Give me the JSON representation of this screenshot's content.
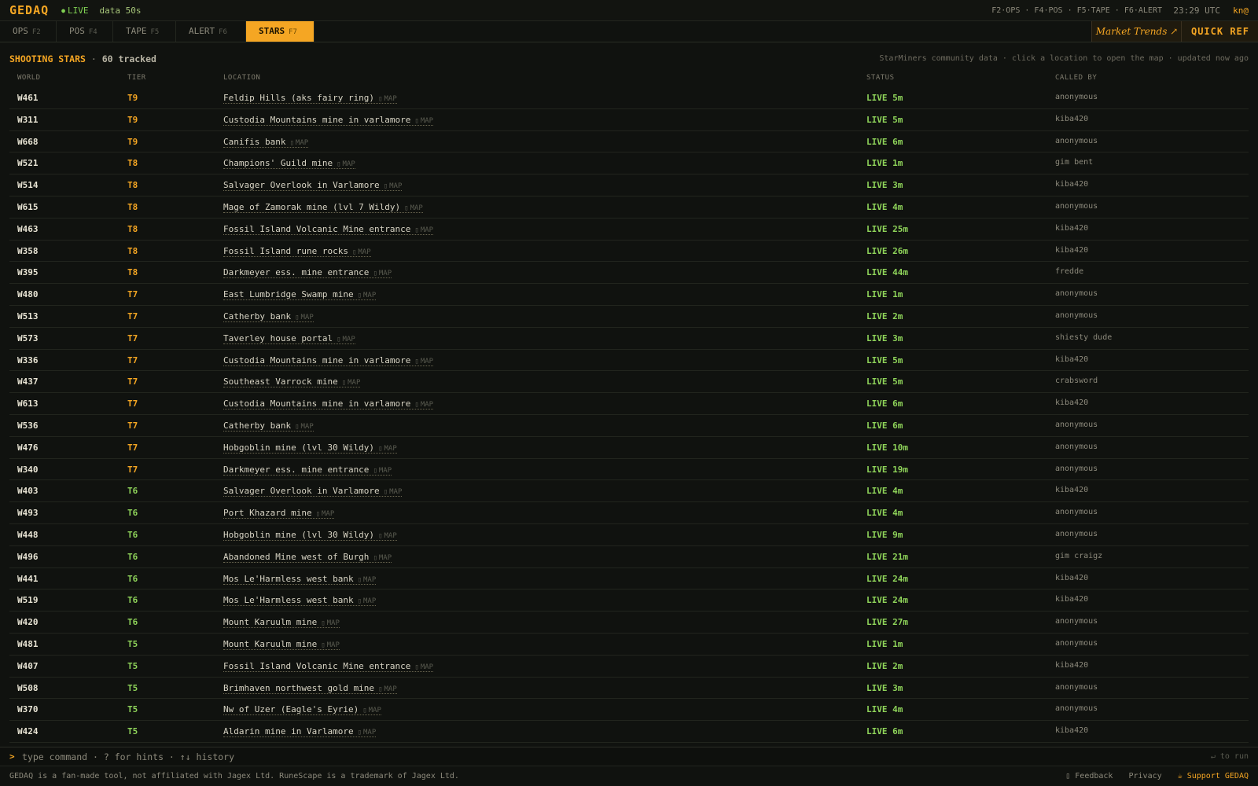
{
  "header": {
    "logo": "GEDAQ",
    "live_dot": "●",
    "live": "LIVE",
    "data_age": "data 50s",
    "hotkeys": "F2·OPS · F4·POS · F5·TAPE · F6·ALERT",
    "clock": "23:29 UTC",
    "user": "kn@"
  },
  "tabs": [
    {
      "label": "OPS",
      "key": "F2"
    },
    {
      "label": "POS",
      "key": "F4"
    },
    {
      "label": "TAPE",
      "key": "F5"
    },
    {
      "label": "ALERT",
      "key": "F6"
    },
    {
      "label": "STARS",
      "key": "F7"
    }
  ],
  "active_tab": "STARS",
  "right_buttons": {
    "trends": "Market Trends ↗",
    "quickref": "QUICK REF"
  },
  "section": {
    "title": "SHOOTING STARS",
    "sep": " · ",
    "count": "60 tracked",
    "note": "StarMiners community data · click a location to open the map · updated now ago"
  },
  "columns": {
    "world": "WORLD",
    "tier": "TIER",
    "location": "LOCATION",
    "status": "STATUS",
    "called_by": "CALLED BY"
  },
  "map_label": "MAP",
  "map_icon": "▯",
  "colors": {
    "accent": "#f5a623",
    "live": "#8fd45a",
    "background": "#10120f"
  },
  "rows": [
    {
      "world": "W461",
      "tier": "T9",
      "location": "Feldip Hills (aks fairy ring)",
      "status": "LIVE 5m",
      "caller": "anonymous"
    },
    {
      "world": "W311",
      "tier": "T9",
      "location": "Custodia Mountains mine in varlamore",
      "status": "LIVE 5m",
      "caller": "kiba420"
    },
    {
      "world": "W668",
      "tier": "T9",
      "location": "Canifis bank",
      "status": "LIVE 6m",
      "caller": "anonymous"
    },
    {
      "world": "W521",
      "tier": "T8",
      "location": "Champions' Guild mine",
      "status": "LIVE 1m",
      "caller": "gim bent"
    },
    {
      "world": "W514",
      "tier": "T8",
      "location": "Salvager Overlook in Varlamore",
      "status": "LIVE 3m",
      "caller": "kiba420"
    },
    {
      "world": "W615",
      "tier": "T8",
      "location": "Mage of Zamorak mine (lvl 7 Wildy)",
      "status": "LIVE 4m",
      "caller": "anonymous"
    },
    {
      "world": "W463",
      "tier": "T8",
      "location": "Fossil Island Volcanic Mine entrance",
      "status": "LIVE 25m",
      "caller": "kiba420"
    },
    {
      "world": "W358",
      "tier": "T8",
      "location": "Fossil Island rune rocks",
      "status": "LIVE 26m",
      "caller": "kiba420"
    },
    {
      "world": "W395",
      "tier": "T8",
      "location": "Darkmeyer ess. mine entrance",
      "status": "LIVE 44m",
      "caller": "fredde"
    },
    {
      "world": "W480",
      "tier": "T7",
      "location": "East Lumbridge Swamp mine",
      "status": "LIVE 1m",
      "caller": "anonymous"
    },
    {
      "world": "W513",
      "tier": "T7",
      "location": "Catherby bank",
      "status": "LIVE 2m",
      "caller": "anonymous"
    },
    {
      "world": "W573",
      "tier": "T7",
      "location": "Taverley house portal",
      "status": "LIVE 3m",
      "caller": "shiesty dude"
    },
    {
      "world": "W336",
      "tier": "T7",
      "location": "Custodia Mountains mine in varlamore",
      "status": "LIVE 5m",
      "caller": "kiba420"
    },
    {
      "world": "W437",
      "tier": "T7",
      "location": "Southeast Varrock mine",
      "status": "LIVE 5m",
      "caller": "crabsword"
    },
    {
      "world": "W613",
      "tier": "T7",
      "location": "Custodia Mountains mine in varlamore",
      "status": "LIVE 6m",
      "caller": "kiba420"
    },
    {
      "world": "W536",
      "tier": "T7",
      "location": "Catherby bank",
      "status": "LIVE 6m",
      "caller": "anonymous"
    },
    {
      "world": "W476",
      "tier": "T7",
      "location": "Hobgoblin mine (lvl 30 Wildy)",
      "status": "LIVE 10m",
      "caller": "anonymous"
    },
    {
      "world": "W340",
      "tier": "T7",
      "location": "Darkmeyer ess. mine entrance",
      "status": "LIVE 19m",
      "caller": "anonymous"
    },
    {
      "world": "W403",
      "tier": "T6",
      "location": "Salvager Overlook in Varlamore",
      "status": "LIVE 4m",
      "caller": "kiba420"
    },
    {
      "world": "W493",
      "tier": "T6",
      "location": "Port Khazard mine",
      "status": "LIVE 4m",
      "caller": "anonymous"
    },
    {
      "world": "W448",
      "tier": "T6",
      "location": "Hobgoblin mine (lvl 30 Wildy)",
      "status": "LIVE 9m",
      "caller": "anonymous"
    },
    {
      "world": "W496",
      "tier": "T6",
      "location": "Abandoned Mine west of Burgh",
      "status": "LIVE 21m",
      "caller": "gim craigz"
    },
    {
      "world": "W441",
      "tier": "T6",
      "location": "Mos Le'Harmless west bank",
      "status": "LIVE 24m",
      "caller": "kiba420"
    },
    {
      "world": "W519",
      "tier": "T6",
      "location": "Mos Le'Harmless west bank",
      "status": "LIVE 24m",
      "caller": "kiba420"
    },
    {
      "world": "W420",
      "tier": "T6",
      "location": "Mount Karuulm mine",
      "status": "LIVE 27m",
      "caller": "anonymous"
    },
    {
      "world": "W481",
      "tier": "T5",
      "location": "Mount Karuulm mine",
      "status": "LIVE 1m",
      "caller": "anonymous"
    },
    {
      "world": "W407",
      "tier": "T5",
      "location": "Fossil Island Volcanic Mine entrance",
      "status": "LIVE 2m",
      "caller": "kiba420"
    },
    {
      "world": "W508",
      "tier": "T5",
      "location": "Brimhaven northwest gold mine",
      "status": "LIVE 3m",
      "caller": "anonymous"
    },
    {
      "world": "W370",
      "tier": "T5",
      "location": "Nw of Uzer (Eagle's Eyrie)",
      "status": "LIVE 4m",
      "caller": "anonymous"
    },
    {
      "world": "W424",
      "tier": "T5",
      "location": "Aldarin mine in Varlamore",
      "status": "LIVE 6m",
      "caller": "kiba420"
    }
  ],
  "command": {
    "prompt": ">",
    "placeholder": "type command · ? for hints · ↑↓ history",
    "run_hint": "↵ to run"
  },
  "footer": {
    "disclaimer": "GEDAQ is a fan-made tool, not affiliated with Jagex Ltd. RuneScape is a trademark of Jagex Ltd.",
    "feedback": "▯ Feedback",
    "privacy": "Privacy",
    "support": "☕ Support GEDAQ"
  }
}
